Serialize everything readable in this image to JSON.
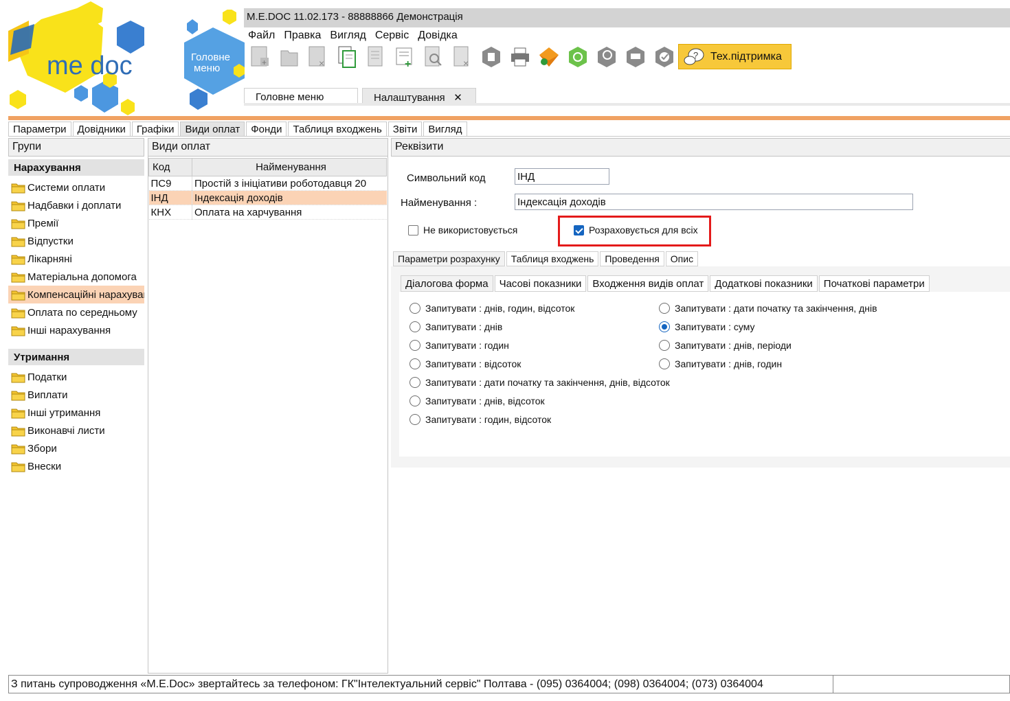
{
  "window": {
    "title": "M.E.DOC 11.02.173  - 88888866 Демонстрація"
  },
  "logo": {
    "text": "me doc"
  },
  "home_button": {
    "label_line1": "Головне",
    "label_line2": "меню"
  },
  "menu": [
    "Файл",
    "Правка",
    "Вигляд",
    "Сервіс",
    "Довідка"
  ],
  "toolbar": {
    "icons": [
      "new-doc-icon",
      "open-doc-icon",
      "delete-doc-icon",
      "copy-icon",
      "document-icon",
      "add-row-icon",
      "search-doc-icon",
      "remove-row-icon",
      "archive-icon",
      "print-icon",
      "send-icon",
      "refresh-icon",
      "search-icon",
      "inbox-icon",
      "verify-icon"
    ],
    "support_label": "Тех.підтримка"
  },
  "doc_tabs": [
    {
      "label": "Головне меню",
      "active": false
    },
    {
      "label": "Налаштування",
      "active": true,
      "close": "✕"
    }
  ],
  "settings_tabs": [
    "Параметри",
    "Довідники",
    "Графіки",
    "Види оплат",
    "Фонди",
    "Таблиця входжень",
    "Звіти",
    "Вигляд"
  ],
  "groups": {
    "header": "Групи",
    "accruals_title": "Нарахування",
    "accruals": [
      "Системи оплати",
      "Надбавки і доплати",
      "Премії",
      "Відпустки",
      "Лікарняні",
      "Матеріальна допомога",
      "Компенсаційні нарахування",
      "Оплата по середньому",
      "Інші нарахування"
    ],
    "deductions_title": "Утримання",
    "deductions": [
      "Податки",
      "Виплати",
      "Інші утримання",
      "Виконавчі листи",
      "Збори",
      "Внески"
    ]
  },
  "types": {
    "header": "Види оплат",
    "columns": [
      "Код",
      "Найменування"
    ],
    "rows": [
      {
        "code": "ПС9",
        "name": "Простій з ініціативи роботодавця 20"
      },
      {
        "code": "ІНД",
        "name": "Індексація доходів"
      },
      {
        "code": "КНХ",
        "name": "Оплата на харчування"
      }
    ]
  },
  "details": {
    "header": "Реквізити",
    "code_label": "Символьний код",
    "code_value": "ІНД",
    "name_label": "Найменування :",
    "name_value": "Індексація доходів",
    "not_used_label": "Не використовується",
    "calc_all_label": "Розраховується для всіх",
    "tabs": [
      "Параметри розрахунку",
      "Таблиця входжень",
      "Проведення",
      "Опис"
    ],
    "subtabs": [
      "Діалогова форма",
      "Часові показники",
      "Входження видів оплат",
      "Додаткові показники",
      "Початкові параметри"
    ],
    "radios_left": [
      "Запитувати : днів, годин, відсоток",
      "Запитувати : днів",
      "Запитувати : годин",
      "Запитувати : відсоток",
      "Запитувати : дати початку та закінчення, днів, відсоток",
      "Запитувати : днів, відсоток",
      "Запитувати : годин, відсоток"
    ],
    "radios_right": [
      "Запитувати : дати початку та закінчення, днів",
      "Запитувати : суму",
      "Запитувати : днів, періоди",
      "Запитувати : днів, годин"
    ]
  },
  "status": {
    "text": "З питань супроводження «M.E.Doc» звертайтесь за телефоном: ГК\"Інтелектуальний сервіс\" Полтава - (095) 0364004;  (098) 0364004;  (073) 0364004"
  },
  "colors": {
    "accent_orange": "#f0a263",
    "selection": "#fbd3b5",
    "support_yellow": "#f7c83a",
    "highlight_red": "#e41a1a"
  }
}
